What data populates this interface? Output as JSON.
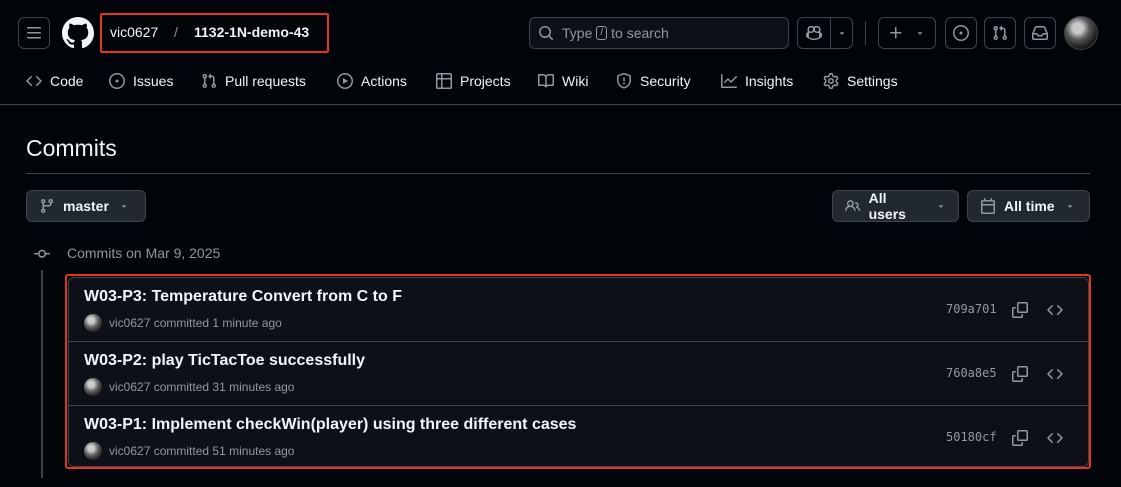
{
  "header": {
    "owner": "vic0627",
    "separator": "/",
    "repo": "1132-1N-demo-43",
    "search": {
      "prefix": "Type",
      "key": "/",
      "suffix": "to search"
    }
  },
  "nav": [
    {
      "label": "Code",
      "icon": "code-icon"
    },
    {
      "label": "Issues",
      "icon": "issue-icon"
    },
    {
      "label": "Pull requests",
      "icon": "pull-request-icon"
    },
    {
      "label": "Actions",
      "icon": "play-icon"
    },
    {
      "label": "Projects",
      "icon": "table-icon"
    },
    {
      "label": "Wiki",
      "icon": "book-icon"
    },
    {
      "label": "Security",
      "icon": "shield-icon"
    },
    {
      "label": "Insights",
      "icon": "graph-icon"
    },
    {
      "label": "Settings",
      "icon": "gear-icon"
    }
  ],
  "page": {
    "title": "Commits",
    "branch": "master",
    "users_filter": "All users",
    "time_filter": "All time",
    "group_heading": "Commits on Mar 9, 2025"
  },
  "commits": [
    {
      "message": "W03-P3: Temperature Convert from C to F",
      "author": "vic0627",
      "action": "committed",
      "time": "1 minute ago",
      "sha": "709a701"
    },
    {
      "message": "W03-P2: play TicTacToe successfully",
      "author": "vic0627",
      "action": "committed",
      "time": "31 minutes ago",
      "sha": "760a8e5"
    },
    {
      "message": "W03-P1: Implement checkWin(player) using three different cases",
      "author": "vic0627",
      "action": "committed",
      "time": "51 minutes ago",
      "sha": "50180cf"
    }
  ],
  "colors": {
    "background": "#010409",
    "border": "#3d444d",
    "muted": "#9198a1",
    "highlight": "#e5341f"
  }
}
